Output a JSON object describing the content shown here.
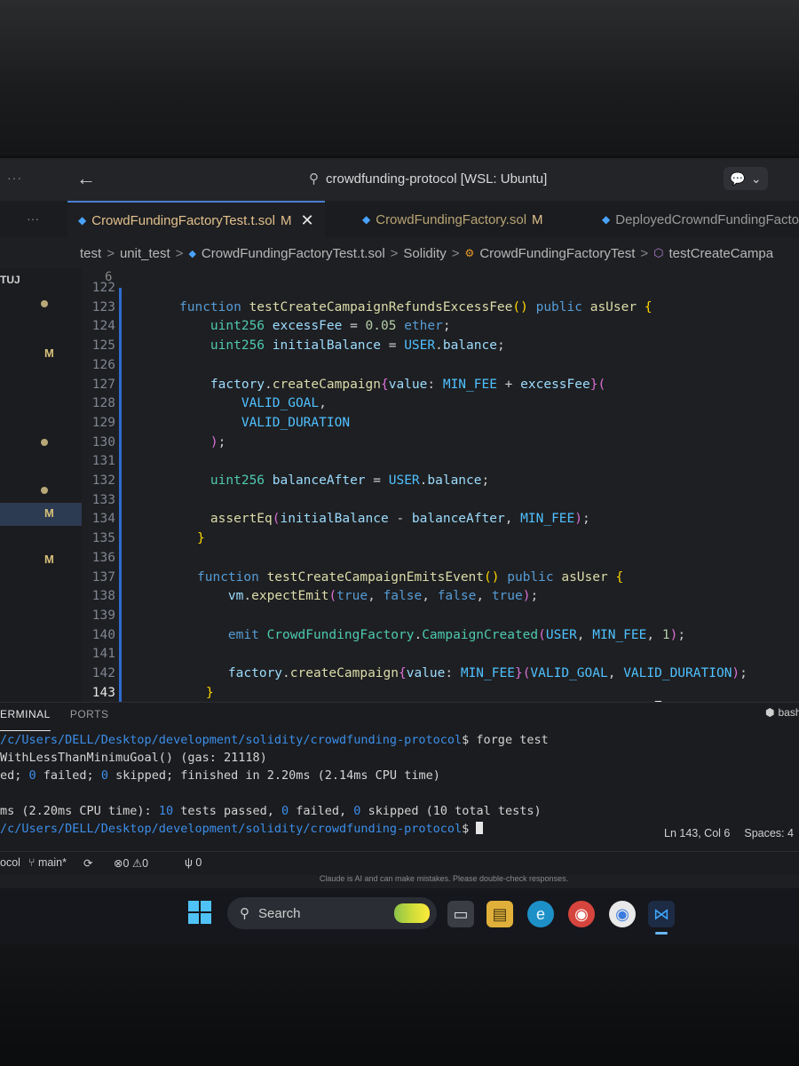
{
  "window": {
    "search_text": "crowdfunding-protocol [WSL: Ubuntu]",
    "menu_ellipsis": "···"
  },
  "tabs": [
    {
      "label": "CrowdFundingFactoryTest.t.sol",
      "badge": "M",
      "active": true
    },
    {
      "label": "CrowdFundingFactory.sol",
      "badge": "M",
      "active": false
    },
    {
      "label": "DeployedCrowndFundingFacto",
      "badge": "",
      "active": false
    }
  ],
  "breadcrumb": {
    "items": [
      "test",
      "unit_test",
      "CrowdFundingFactoryTest.t.sol",
      "Solidity",
      "CrowdFundingFactoryTest",
      "testCreateCampa"
    ]
  },
  "sidebar": {
    "label": "TUJ",
    "badges": [
      "M",
      "M",
      "M"
    ]
  },
  "editor": {
    "sticky_line_number": "6",
    "lines": [
      {
        "n": "122",
        "html": ""
      },
      {
        "n": "123",
        "html": "<span class='kw'>function</span> <span class='fn'>testCreateCampaignRefundsExcessFee</span><span class='br1'>()</span> <span class='kw'>public</span> <span class='mod'>asUser</span> <span class='br1'>{</span>"
      },
      {
        "n": "124",
        "html": "    <span class='ty'>uint256</span> <span class='id'>excessFee</span> = <span class='num'>0.05</span> <span class='kw'>ether</span>;"
      },
      {
        "n": "125",
        "html": "    <span class='ty'>uint256</span> <span class='id'>initialBalance</span> = <span class='cst'>USER</span>.<span class='id'>balance</span>;"
      },
      {
        "n": "126",
        "html": ""
      },
      {
        "n": "127",
        "html": "    <span class='id'>factory</span>.<span class='fn'>createCampaign</span><span class='br2'>{</span><span class='id'>value</span>: <span class='cst'>MIN_FEE</span> + <span class='id'>excessFee</span><span class='br2'>}</span><span class='br2'>(</span>"
      },
      {
        "n": "128",
        "html": "        <span class='cst'>VALID_GOAL</span>,"
      },
      {
        "n": "129",
        "html": "        <span class='cst'>VALID_DURATION</span>"
      },
      {
        "n": "130",
        "html": "    <span class='br2'>)</span>;"
      },
      {
        "n": "131",
        "html": ""
      },
      {
        "n": "132",
        "html": "    <span class='ty'>uint256</span> <span class='id'>balanceAfter</span> = <span class='cst'>USER</span>.<span class='id'>balance</span>;"
      },
      {
        "n": "133",
        "html": ""
      },
      {
        "n": "134",
        "html": "    <span class='fn'>assertEq</span><span class='br2'>(</span><span class='id'>initialBalance</span> - <span class='id'>balanceAfter</span>, <span class='cst'>MIN_FEE</span><span class='br2'>)</span>;"
      },
      {
        "n": "135",
        "html": "<span class='br1'>}</span>"
      },
      {
        "n": "136",
        "html": ""
      },
      {
        "n": "137",
        "html": "<span class='kw'>function</span> <span class='fn'>testCreateCampaignEmitsEvent</span><span class='br1'>()</span> <span class='kw'>public</span> <span class='mod'>asUser</span> <span class='br1'>{</span>"
      },
      {
        "n": "138",
        "html": "    <span class='id'>vm</span>.<span class='fn'>expectEmit</span><span class='br2'>(</span><span class='kw'>true</span>, <span class='kw'>false</span>, <span class='kw'>false</span>, <span class='kw'>true</span><span class='br2'>)</span>;"
      },
      {
        "n": "139",
        "html": ""
      },
      {
        "n": "140",
        "html": "    <span class='kw'>emit</span> <span class='ty'>CrowdFundingFactory</span>.<span class='ty'>CampaignCreated</span><span class='br2'>(</span><span class='cst'>USER</span>, <span class='cst'>MIN_FEE</span>, <span class='num'>1</span><span class='br2'>)</span>;"
      },
      {
        "n": "141",
        "html": ""
      },
      {
        "n": "142",
        "html": "    <span class='id'>factory</span>.<span class='fn'>createCampaign</span><span class='br2'>{</span><span class='id'>value</span>: <span class='cst'>MIN_FEE</span><span class='br2'>}</span><span class='br2'>(</span><span class='cst'>VALID_GOAL</span>, <span class='cst'>VALID_DURATION</span><span class='br2'>)</span>;"
      },
      {
        "n": "143",
        "html": "<span class='br1'>}</span>"
      }
    ]
  },
  "panel": {
    "tabs": [
      "ERMINAL",
      "PORTS"
    ],
    "shell_label": "bash",
    "terminal_lines": [
      {
        "html": "<span class='path'>/c/Users/DELL/Desktop/development/solidity/crowdfunding-protocol</span>$ forge test"
      },
      {
        "html": "WithLessThanMinimuGoal() (gas: 21118)"
      },
      {
        "html": "ed; <span class='zero'>0</span> failed; <span class='zero'>0</span> skipped; finished in 2.20ms (2.14ms CPU time)"
      },
      {
        "html": ""
      },
      {
        "html": "ms (2.20ms CPU time): <span class='pass'>10</span> tests passed, <span class='zero'>0</span> failed, <span class='zero'>0</span> skipped (10 total tests)"
      },
      {
        "html": "<span class='path'>/c/Users/DELL/Desktop/development/solidity/crowdfunding-protocol</span>$ <span class='cursor'></span>"
      }
    ],
    "cursor_pos": "Ln 143, Col 6",
    "spaces": "Spaces: 4"
  },
  "statusbar": {
    "left_fragment": "ocol",
    "branch": "main*",
    "errors": "0",
    "warnings": "0",
    "ports": "0"
  },
  "disclaimer": "Claude is AI and can make mistakes. Please double-check responses.",
  "taskbar": {
    "search_placeholder": "Search"
  }
}
